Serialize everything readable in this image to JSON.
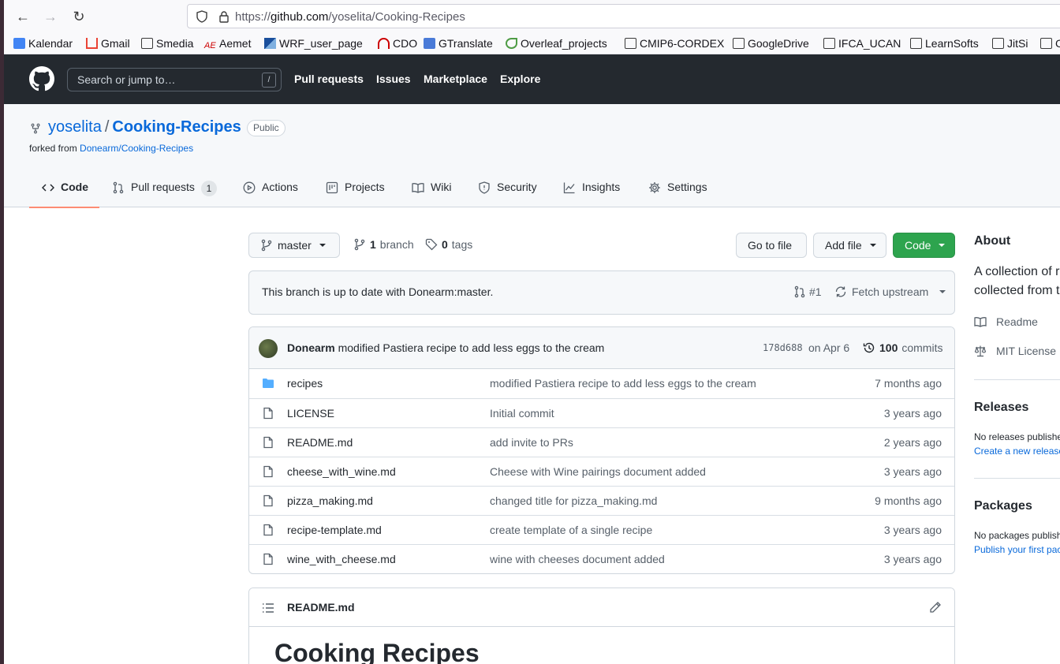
{
  "browser": {
    "url_prefix": "https://",
    "url_domain": "github.com",
    "url_path": "/yoselita/Cooking-Recipes",
    "bookmarks": [
      "Kalendar",
      "Gmail",
      "Smedia",
      "Aemet",
      "WRF_user_page",
      "CDO",
      "GTranslate",
      "Overleaf_projects",
      "CMIP6-CORDEX",
      "GoogleDrive",
      "IFCA_UCAN",
      "LearnSofts",
      "JitSi",
      "C"
    ]
  },
  "gh": {
    "search_placeholder": "Search or jump to…",
    "search_key": "/",
    "nav": [
      "Pull requests",
      "Issues",
      "Marketplace",
      "Explore"
    ]
  },
  "repo": {
    "owner": "yoselita",
    "separator": "/",
    "name": "Cooking-Recipes",
    "visibility": "Public",
    "forked_label": "forked from",
    "forked_from": "Donearm/Cooking-Recipes",
    "tabs": [
      {
        "label": "Code",
        "icon": "code-icon"
      },
      {
        "label": "Pull requests",
        "icon": "pull-request-icon",
        "count": "1"
      },
      {
        "label": "Actions",
        "icon": "play-icon"
      },
      {
        "label": "Projects",
        "icon": "project-icon"
      },
      {
        "label": "Wiki",
        "icon": "book-icon"
      },
      {
        "label": "Security",
        "icon": "shield-icon"
      },
      {
        "label": "Insights",
        "icon": "graph-icon"
      },
      {
        "label": "Settings",
        "icon": "gear-icon"
      }
    ]
  },
  "filenav": {
    "branch": "master",
    "branch_count": "1",
    "branch_label": "branch",
    "tag_count": "0",
    "tag_label": "tags",
    "go_to_file": "Go to file",
    "add_file": "Add file",
    "code": "Code"
  },
  "upstream": {
    "message": "This branch is up to date with Donearm:master.",
    "pr": "#1",
    "fetch": "Fetch upstream"
  },
  "commit": {
    "author": "Donearm",
    "message": "modified Pastiera recipe to add less eggs to the cream",
    "sha": "178d688",
    "date": "on Apr 6",
    "count": "100",
    "count_label": "commits"
  },
  "files": [
    {
      "name": "recipes",
      "type": "dir",
      "message": "modified Pastiera recipe to add less eggs to the cream",
      "age": "7 months ago"
    },
    {
      "name": "LICENSE",
      "type": "file",
      "message": "Initial commit",
      "age": "3 years ago"
    },
    {
      "name": "README.md",
      "type": "file",
      "message": "add invite to PRs",
      "age": "2 years ago"
    },
    {
      "name": "cheese_with_wine.md",
      "type": "file",
      "message": "Cheese with Wine pairings document added",
      "age": "3 years ago"
    },
    {
      "name": "pizza_making.md",
      "type": "file",
      "message": "changed title for pizza_making.md",
      "age": "9 months ago"
    },
    {
      "name": "recipe-template.md",
      "type": "file",
      "message": "create template of a single recipe",
      "age": "3 years ago"
    },
    {
      "name": "wine_with_cheese.md",
      "type": "file",
      "message": "wine with cheeses document added",
      "age": "3 years ago"
    }
  ],
  "readme": {
    "title": "README.md",
    "heading": "Cooking Recipes"
  },
  "sidebar": {
    "about": "About",
    "desc_line1": "A collection of r",
    "desc_line2": "collected from t",
    "readme": "Readme",
    "license": "MIT License",
    "releases": "Releases",
    "no_releases": "No releases publishe",
    "create_release": "Create a new release",
    "packages": "Packages",
    "no_packages": "No packages publish",
    "publish_package": "Publish your first pac"
  }
}
